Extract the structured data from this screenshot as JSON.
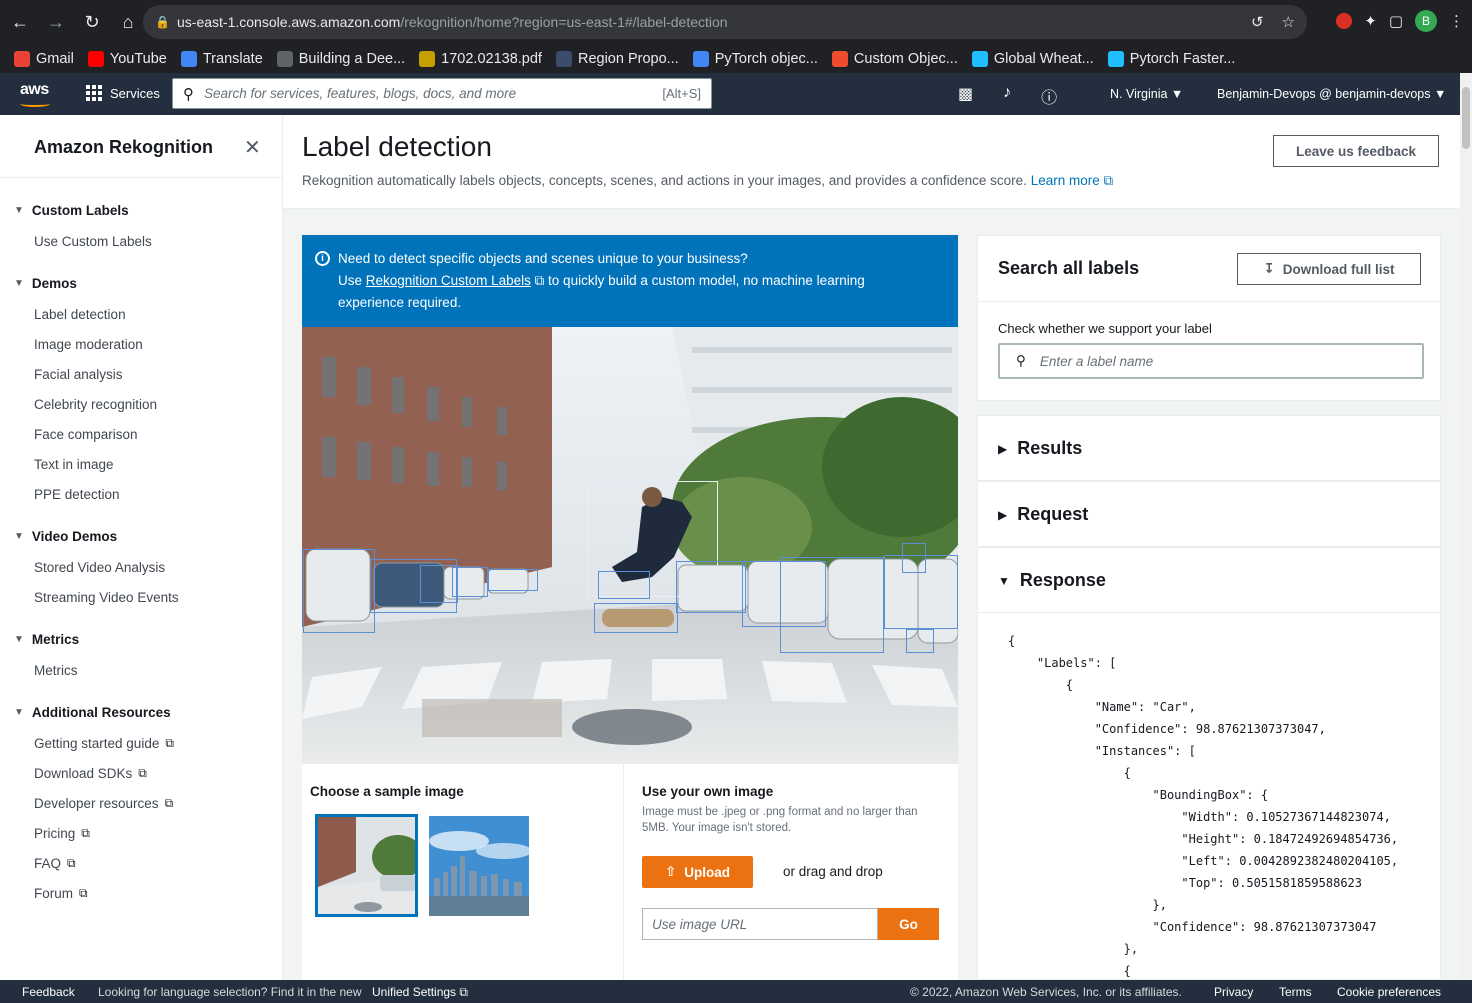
{
  "browser": {
    "url_host": "us-east-1.console.aws.amazon.com",
    "url_path": "/rekognition/home?region=us-east-1#/label-detection",
    "avatar_letter": "B",
    "bookmarks": [
      {
        "label": "Gmail",
        "color": "#ea4335"
      },
      {
        "label": "YouTube",
        "color": "#ff0000"
      },
      {
        "label": "Translate",
        "color": "#4285f4"
      },
      {
        "label": "Building a Dee...",
        "color": "#5f6368"
      },
      {
        "label": "1702.02138.pdf",
        "color": "#c5a000"
      },
      {
        "label": "Region Propo...",
        "color": "#3c4c6c"
      },
      {
        "label": "PyTorch objec...",
        "color": "#4285f4"
      },
      {
        "label": "Custom Objec...",
        "color": "#ee4c2c"
      },
      {
        "label": "Global Wheat...",
        "color": "#20beff"
      },
      {
        "label": "Pytorch Faster...",
        "color": "#20beff"
      }
    ]
  },
  "aws_header": {
    "logo": "aws",
    "services": "Services",
    "search_placeholder": "Search for services, features, blogs, docs, and more",
    "search_shortcut": "[Alt+S]",
    "region": "N. Virginia ▼",
    "account": "Benjamin-Devops @ benjamin-devops ▼"
  },
  "sidebar": {
    "title": "Amazon Rekognition",
    "sections": [
      {
        "label": "Custom Labels",
        "items": [
          "Use Custom Labels"
        ]
      },
      {
        "label": "Demos",
        "items": [
          "Label detection",
          "Image moderation",
          "Facial analysis",
          "Celebrity recognition",
          "Face comparison",
          "Text in image",
          "PPE detection"
        ]
      },
      {
        "label": "Video Demos",
        "items": [
          "Stored Video Analysis",
          "Streaming Video Events"
        ]
      },
      {
        "label": "Metrics",
        "items": [
          "Metrics"
        ]
      },
      {
        "label": "Additional Resources",
        "items": [
          "Getting started guide",
          "Download SDKs",
          "Developer resources",
          "Pricing",
          "FAQ",
          "Forum"
        ]
      }
    ]
  },
  "page": {
    "title": "Label detection",
    "description": "Rekognition automatically labels objects, concepts, scenes, and actions in your images, and provides a confidence score.",
    "learn_more": "Learn more",
    "feedback_button": "Leave us feedback"
  },
  "banner": {
    "line1": "Need to detect specific objects and scenes unique to your business?",
    "use": "Use",
    "link": "Rekognition Custom Labels",
    "line2_rest": "to quickly build a custom model, no machine learning",
    "line3": "experience required."
  },
  "sample": {
    "title": "Choose a sample image"
  },
  "own_image": {
    "title": "Use your own image",
    "note": "Image must be .jpeg or .png format and no larger than 5MB. Your image isn't stored.",
    "upload": "Upload",
    "drag": "or drag and drop",
    "url_placeholder": "Use image URL",
    "go": "Go"
  },
  "search_labels": {
    "title": "Search all labels",
    "download": "Download full list",
    "check_label": "Check whether we support your label",
    "placeholder": "Enter a label name"
  },
  "accordions": {
    "results": "Results",
    "request": "Request",
    "response": "Response"
  },
  "response_json": [
    "{",
    "    \"Labels\": [",
    "        {",
    "            \"Name\": \"Car\",",
    "            \"Confidence\": 98.87621307373047,",
    "            \"Instances\": [",
    "                {",
    "                    \"BoundingBox\": {",
    "                        \"Width\": 0.10527367144823074,",
    "                        \"Height\": 0.18472492694854736,",
    "                        \"Left\": 0.0042892382480204105,",
    "                        \"Top\": 0.5051581859588623",
    "                    },",
    "                    \"Confidence\": 98.87621307373047",
    "                },",
    "                {"
  ],
  "footer": {
    "feedback": "Feedback",
    "lang_text": "Looking for language selection? Find it in the new",
    "unified": "Unified Settings",
    "copyright": "© 2022, Amazon Web Services, Inc. or its affiliates.",
    "privacy": "Privacy",
    "terms": "Terms",
    "cookies": "Cookie preferences"
  }
}
